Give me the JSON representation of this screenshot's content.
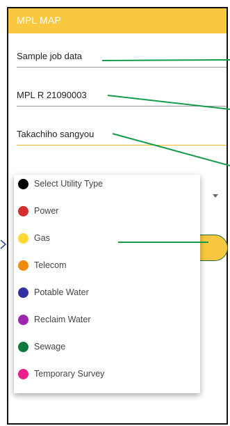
{
  "app": {
    "title": "MPL MAP"
  },
  "fields": {
    "job_name": "Sample job data",
    "job_number": "MPL R 21090003",
    "company": "Takachiho sangyou"
  },
  "colors": {
    "appbar": "#f9c740",
    "annotation_line": "#149c4b"
  },
  "utility_menu": {
    "items": [
      {
        "label": "Select Utility Type",
        "color": "#000000"
      },
      {
        "label": "Power",
        "color": "#d32f2f"
      },
      {
        "label": "Gas",
        "color": "#fdd835"
      },
      {
        "label": "Telecom",
        "color": "#ef8c0b"
      },
      {
        "label": "Potable Water",
        "color": "#3030a0"
      },
      {
        "label": "Reclaim Water",
        "color": "#9c27b0"
      },
      {
        "label": "Sewage",
        "color": "#0f7a3c"
      },
      {
        "label": "Temporary Survey",
        "color": "#e91e8c"
      }
    ]
  }
}
